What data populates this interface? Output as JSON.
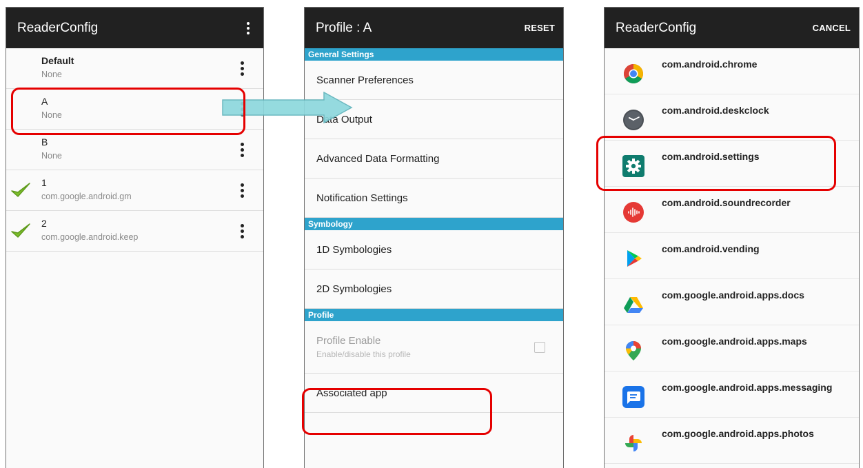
{
  "screen1": {
    "title": "ReaderConfig",
    "profiles": [
      {
        "name": "Default",
        "sub": "None",
        "bold": true,
        "checked": false
      },
      {
        "name": "A",
        "sub": "None",
        "bold": false,
        "checked": false
      },
      {
        "name": "B",
        "sub": "None",
        "bold": false,
        "checked": false
      },
      {
        "name": "1",
        "sub": "com.google.android.gm",
        "bold": false,
        "checked": true
      },
      {
        "name": "2",
        "sub": "com.google.android.keep",
        "bold": false,
        "checked": true
      }
    ]
  },
  "screen2": {
    "title": "Profile : A",
    "reset_label": "RESET",
    "sections": {
      "general": "General Settings",
      "symbology": "Symbology",
      "profile": "Profile"
    },
    "items": {
      "scanner_preferences": "Scanner Preferences",
      "data_output": "Data Output",
      "advanced_data_formatting": "Advanced Data Formatting",
      "notification_settings": "Notification Settings",
      "symbologies_1d": "1D Symbologies",
      "symbologies_2d": "2D Symbologies",
      "profile_enable": "Profile Enable",
      "profile_enable_sub": "Enable/disable this profile",
      "associated_app": "Associated app"
    }
  },
  "screen3": {
    "title": "ReaderConfig",
    "cancel_label": "CANCEL",
    "apps": [
      {
        "name": "com.android.chrome",
        "icon": "chrome-icon"
      },
      {
        "name": "com.android.deskclock",
        "icon": "clock-icon"
      },
      {
        "name": "com.android.settings",
        "icon": "settings-gear-icon"
      },
      {
        "name": "com.android.soundrecorder",
        "icon": "sound-recorder-icon"
      },
      {
        "name": "com.android.vending",
        "icon": "play-store-icon"
      },
      {
        "name": "com.google.android.apps.docs",
        "icon": "drive-icon"
      },
      {
        "name": "com.google.android.apps.maps",
        "icon": "maps-pin-icon"
      },
      {
        "name": "com.google.android.apps.messaging",
        "icon": "messages-icon"
      },
      {
        "name": "com.google.android.apps.photos",
        "icon": "photos-pinwheel-icon"
      }
    ]
  },
  "colors": {
    "appbar": "#212121",
    "section_header": "#2ea3cc",
    "highlight": "#e50000",
    "arrow": "#8dd8dd",
    "check": "#7cbd2b"
  }
}
